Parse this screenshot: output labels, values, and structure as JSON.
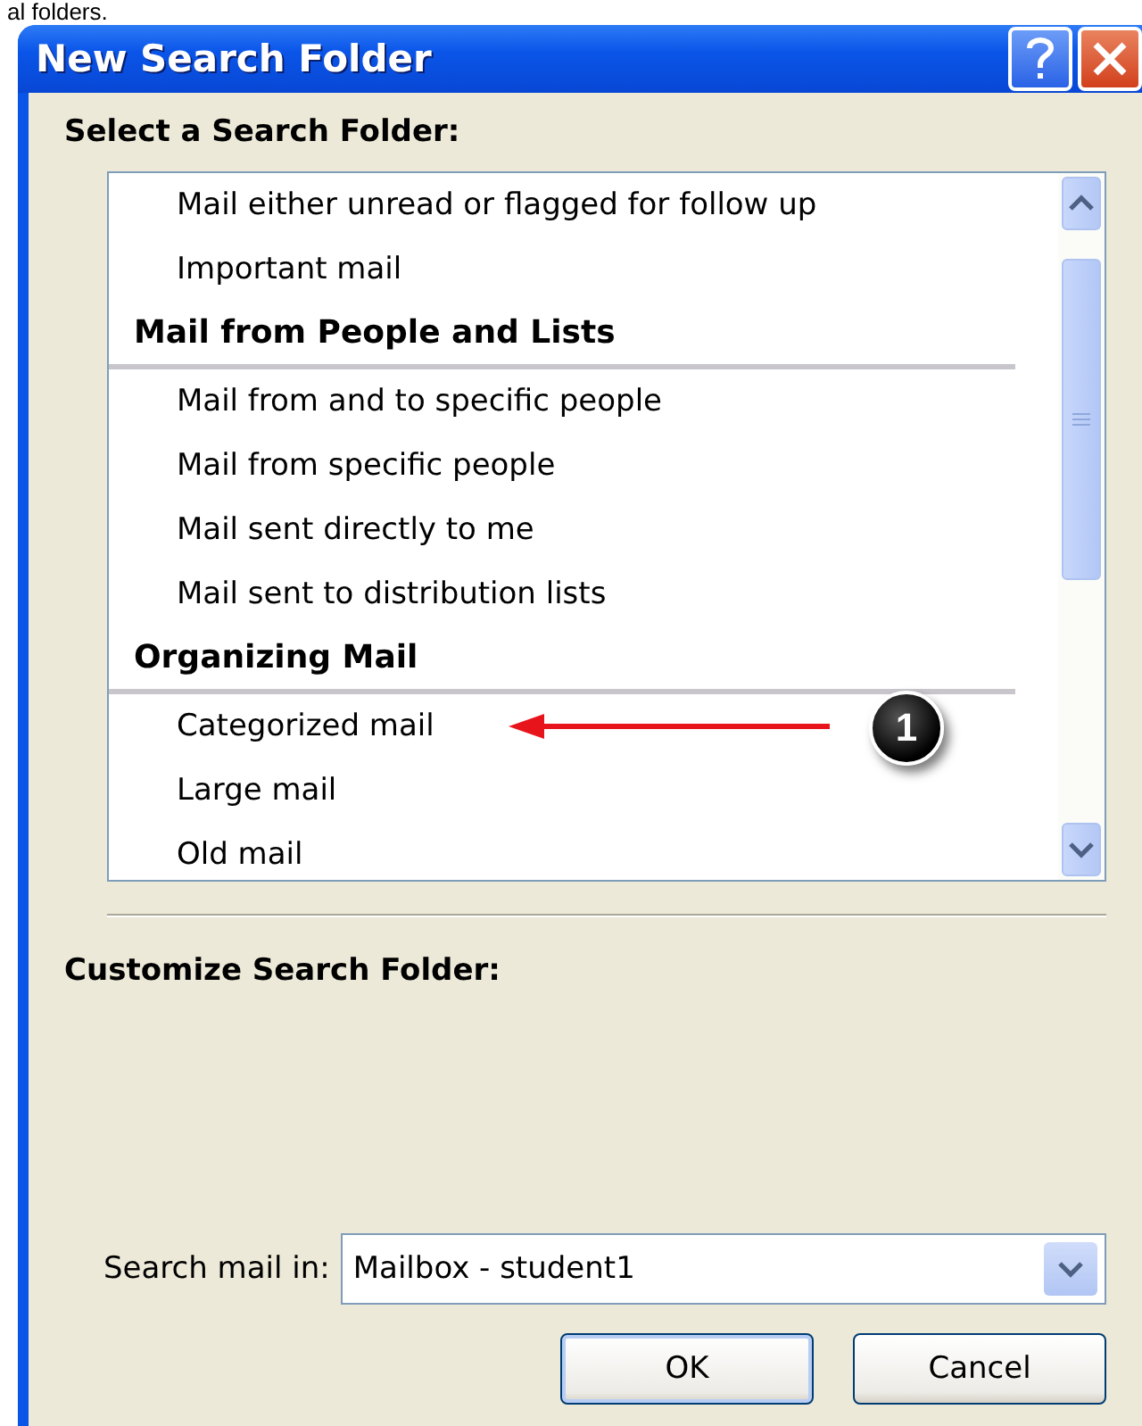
{
  "caption": "al folders.",
  "window": {
    "title": "New Search Folder"
  },
  "select_label": "Select a Search Folder:",
  "list": [
    {
      "kind": "item",
      "label": "Mail either unread or flagged for follow up"
    },
    {
      "kind": "item",
      "label": "Important mail"
    },
    {
      "kind": "header",
      "label": "Mail from People and Lists"
    },
    {
      "kind": "item",
      "label": "Mail from and to specific people"
    },
    {
      "kind": "item",
      "label": "Mail from specific people"
    },
    {
      "kind": "item",
      "label": "Mail sent directly to me"
    },
    {
      "kind": "item",
      "label": "Mail sent to distribution lists"
    },
    {
      "kind": "header",
      "label": "Organizing Mail"
    },
    {
      "kind": "item",
      "label": "Categorized mail",
      "callout": "1"
    },
    {
      "kind": "item",
      "label": "Large mail"
    },
    {
      "kind": "item",
      "label": "Old mail"
    }
  ],
  "customize_label": "Customize Search Folder:",
  "search_in": {
    "label": "Search mail in:",
    "value": "Mailbox - student1"
  },
  "buttons": [
    {
      "label": "OK",
      "default": true
    },
    {
      "label": "Cancel",
      "default": false
    }
  ]
}
